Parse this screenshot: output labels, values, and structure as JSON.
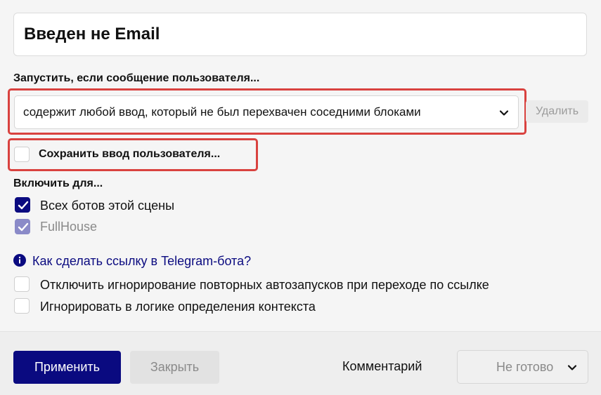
{
  "block": {
    "name": "Введен не Email"
  },
  "trigger": {
    "label": "Запустить, если сообщение пользователя...",
    "selected": "содержит любой ввод, который не был перехвачен соседними блоками",
    "delete_label": "Удалить"
  },
  "save_input": {
    "label": "Сохранить ввод пользователя...",
    "checked": false
  },
  "enable_for": {
    "label": "Включить для...",
    "items": [
      {
        "label": "Всех ботов этой сцены",
        "checked": true
      },
      {
        "label": "FullHouse",
        "checked": true
      }
    ]
  },
  "help_link": {
    "label": "Как сделать ссылку в Telegram-бота?"
  },
  "options": [
    {
      "label": "Отключить игнорирование повторных автозапусков при переходе по ссылке",
      "checked": false
    },
    {
      "label": "Игнорировать в логике определения контекста",
      "checked": false
    }
  ],
  "footer": {
    "apply_label": "Применить",
    "close_label": "Закрыть",
    "comment_label": "Комментарий",
    "status_value": "Не готово"
  },
  "colors": {
    "primary": "#0a0a80",
    "highlight": "#d9423f",
    "checked_dim": "#8a8ac8"
  }
}
